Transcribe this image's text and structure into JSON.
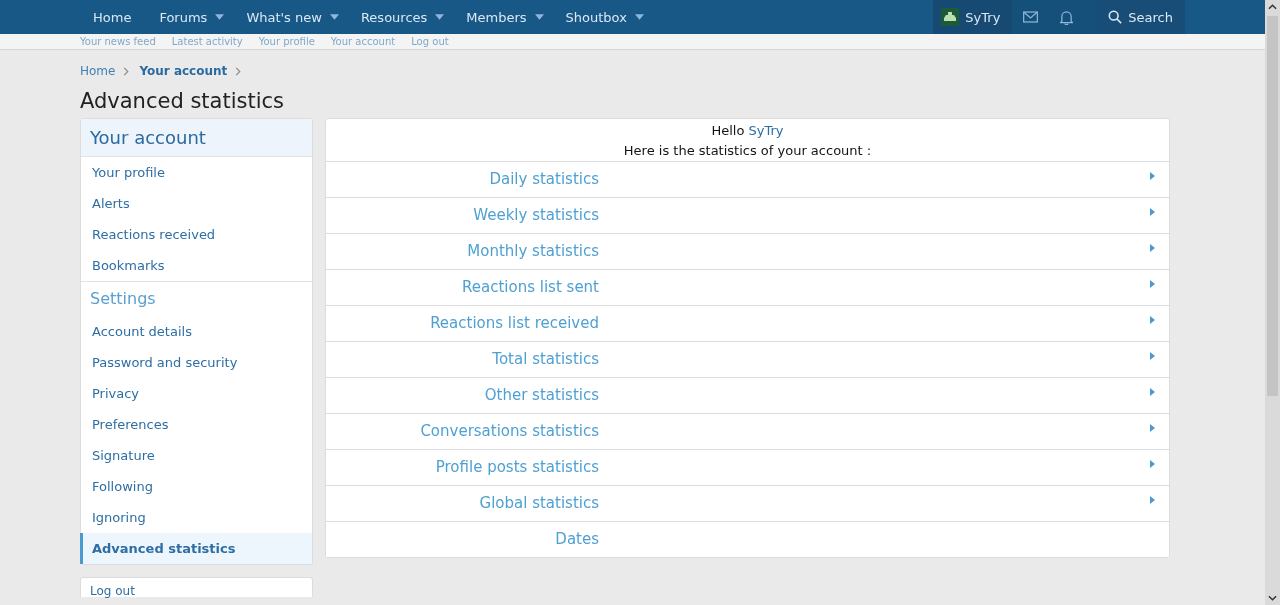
{
  "nav": {
    "items": [
      {
        "label": "Home",
        "dropdown": false
      },
      {
        "label": "Forums",
        "dropdown": true
      },
      {
        "label": "What's new",
        "dropdown": true
      },
      {
        "label": "Resources",
        "dropdown": true
      },
      {
        "label": "Members",
        "dropdown": true
      },
      {
        "label": "Shoutbox",
        "dropdown": true
      }
    ],
    "user": "SyTry",
    "search": "Search"
  },
  "subnav": [
    "Your news feed",
    "Latest activity",
    "Your profile",
    "Your account",
    "Log out"
  ],
  "breadcrumb": [
    "Home",
    "Your account"
  ],
  "title": "Advanced statistics",
  "sidebar": {
    "sections": [
      {
        "heading": "Your account",
        "kind": "primary",
        "items": [
          {
            "label": "Your profile",
            "selected": false
          },
          {
            "label": "Alerts",
            "selected": false
          },
          {
            "label": "Reactions received",
            "selected": false
          },
          {
            "label": "Bookmarks",
            "selected": false
          }
        ]
      },
      {
        "heading": "Settings",
        "kind": "secondary",
        "items": [
          {
            "label": "Account details",
            "selected": false
          },
          {
            "label": "Password and security",
            "selected": false
          },
          {
            "label": "Privacy",
            "selected": false
          },
          {
            "label": "Preferences",
            "selected": false
          },
          {
            "label": "Signature",
            "selected": false
          },
          {
            "label": "Following",
            "selected": false
          },
          {
            "label": "Ignoring",
            "selected": false
          },
          {
            "label": "Advanced statistics",
            "selected": true
          }
        ]
      }
    ],
    "logout": "Log out"
  },
  "main": {
    "greeting": "Hello",
    "username": "SyTry",
    "intro": "Here is the statistics of your account :",
    "rows": [
      {
        "label": "Daily statistics",
        "collapsible": true
      },
      {
        "label": "Weekly statistics",
        "collapsible": true
      },
      {
        "label": "Monthly statistics",
        "collapsible": true
      },
      {
        "label": "Reactions list sent",
        "collapsible": true
      },
      {
        "label": "Reactions list received",
        "collapsible": true
      },
      {
        "label": "Total statistics",
        "collapsible": true
      },
      {
        "label": "Other statistics",
        "collapsible": true
      },
      {
        "label": "Conversations statistics",
        "collapsible": true
      },
      {
        "label": "Profile posts statistics",
        "collapsible": true
      },
      {
        "label": "Global statistics",
        "collapsible": true
      },
      {
        "label": "Dates",
        "collapsible": false
      }
    ]
  }
}
